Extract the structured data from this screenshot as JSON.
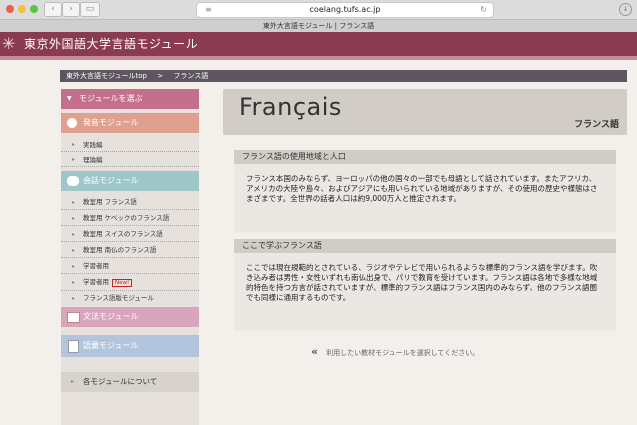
{
  "browser": {
    "url": "coelang.tufs.ac.jp",
    "tab_title": "東外大言語モジュール | フランス語"
  },
  "banner": {
    "title": "東京外国語大学言語モジュール"
  },
  "breadcrumb": {
    "home": "東外大言語モジュールtop",
    "sep": ">",
    "current": "フランス語"
  },
  "sidebar": {
    "select_module": "モジュールを選ぶ",
    "pronunciation": "発音モジュール",
    "pron_items": [
      "実践編",
      "理論編"
    ],
    "conversation": "会話モジュール",
    "conv_items": [
      "教室用 フランス語",
      "教室用 ケベックのフランス語",
      "教室用 スイスのフランス語",
      "教室用 南仏のフランス語",
      "学習者用",
      "学習者用",
      "フランス語版モジュール"
    ],
    "new_badge": "New!",
    "grammar": "文法モジュール",
    "vocabulary": "語彙モジュール",
    "about": "各モジュールについて"
  },
  "main": {
    "title": "Français",
    "subtitle": "フランス語",
    "section1_title": "フランス語の使用地域と人口",
    "section1_body": "フランス本国のみならず、ヨーロッパの他の国々の一部でも母語として話されています。またアフリカ、アメリカの大陸や島々、およびアジアにも用いられている地域がありますが、その使用の歴史や様態はさまざまです。全世界の話者人口は約9,000万人と推定されます。",
    "section2_title": "ここで学ぶフランス語",
    "section2_body": "ここでは現在規範的とされている、ラジオやテレビで用いられるような標準的フランス語を学びます。吹き込み者は男性・女性いずれも南仏出身で、パリで教育を受けています。フランス語は各地で多様な地域的特色を持つ方言が話されていますが、標準的フランス語はフランス国内のみならず、他のフランス語圏でも同様に通用するものです。",
    "footer_arrow": "«",
    "footer_note": "利用したい教材モジュールを選択してください。"
  },
  "colors": {
    "banner": "#8a3b52",
    "select_module": "#c46f8c",
    "pronunciation": "#e0a08f",
    "conversation": "#9fc7c9",
    "grammar": "#d9a5bd",
    "vocabulary": "#b3c5dc"
  }
}
